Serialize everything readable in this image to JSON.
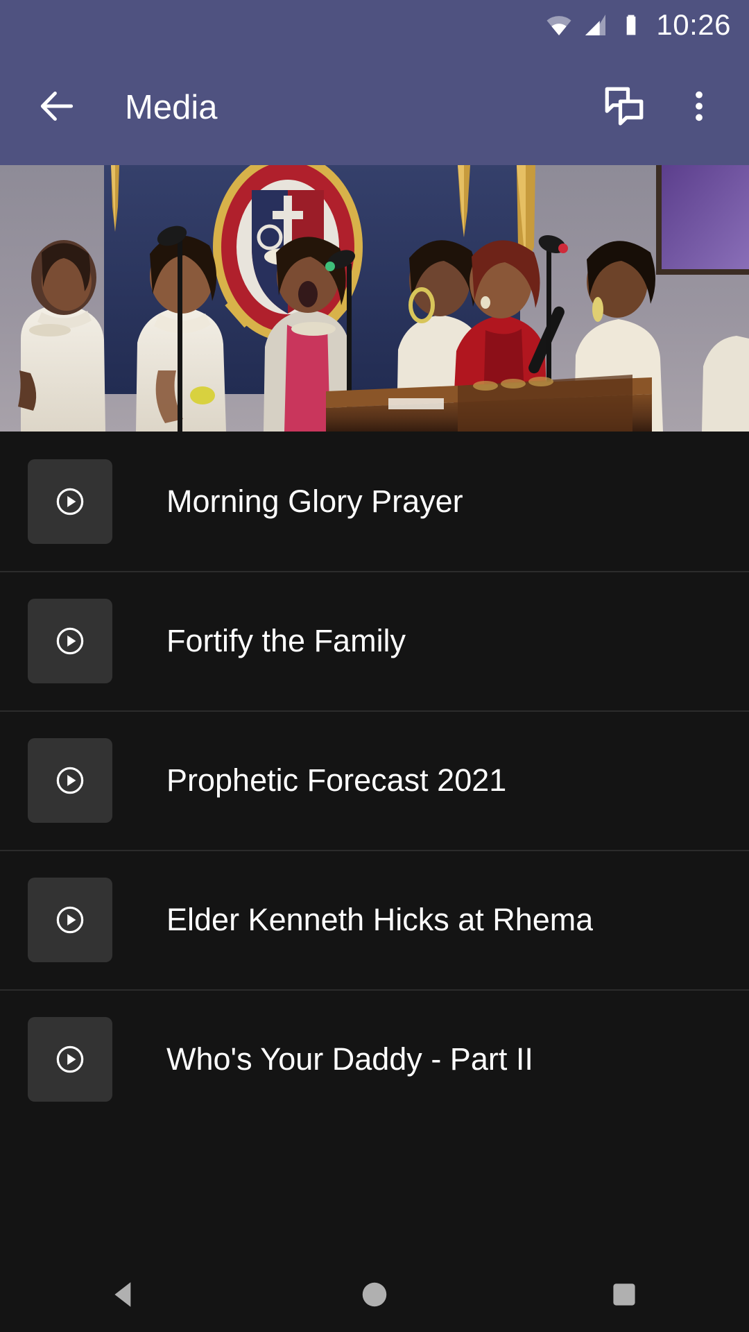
{
  "status_bar": {
    "time": "10:26",
    "icons": [
      {
        "name": "wifi-icon",
        "label": "wifi"
      },
      {
        "name": "cellular-signal-icon",
        "label": "cellular signal"
      },
      {
        "name": "battery-icon",
        "label": "battery full"
      }
    ]
  },
  "app_bar": {
    "back_label": "back-arrow-icon",
    "title": "Media",
    "actions": [
      {
        "name": "chat-icon",
        "label": "chat"
      },
      {
        "name": "overflow-menu-icon",
        "label": "more options"
      }
    ]
  },
  "hero": {
    "name": "media-hero-image",
    "alt": "Church choir of women singing into microphones in front of a church seal emblem"
  },
  "media_list": {
    "items": [
      {
        "title": "Morning Glory Prayer",
        "thumb_icon": "play-circle-icon"
      },
      {
        "title": "Fortify the Family",
        "thumb_icon": "play-circle-icon"
      },
      {
        "title": "Prophetic Forecast 2021",
        "thumb_icon": "play-circle-icon"
      },
      {
        "title": "Elder Kenneth Hicks at Rhema",
        "thumb_icon": "play-circle-icon"
      },
      {
        "title": "Who's Your Daddy - Part II",
        "thumb_icon": "play-circle-icon"
      }
    ]
  },
  "nav_bar": {
    "buttons": [
      {
        "name": "nav-back-button",
        "label": "Back"
      },
      {
        "name": "nav-home-button",
        "label": "Home"
      },
      {
        "name": "nav-recents-button",
        "label": "Recents"
      }
    ]
  },
  "colors": {
    "app_bar": "#4F5280",
    "background": "#141414",
    "divider": "#2c2c2c",
    "thumb": "#333333",
    "text_primary": "#ffffff",
    "nav_icon": "#b0b0b0"
  }
}
